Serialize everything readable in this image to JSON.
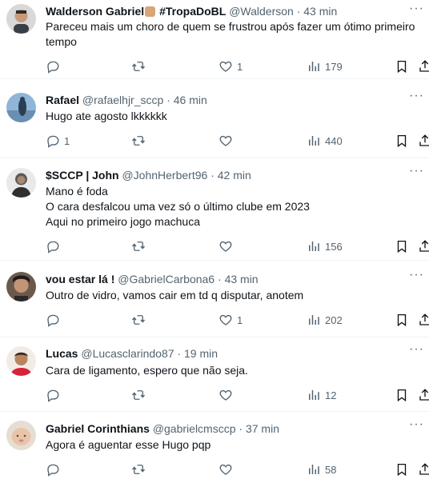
{
  "tweets": [
    {
      "name": "Walderson Gabriel",
      "name_suffix": "#TropaDoBL",
      "handle": "@Walderson",
      "time": "43 min",
      "lines": [
        "Pareceu mais um choro de quem se frustrou após fazer um ótimo primeiro",
        "tempo"
      ],
      "replies": "",
      "likes": "1",
      "views": "179"
    },
    {
      "name": "Rafael",
      "handle": "@rafaelhjr_sccp",
      "time": "46 min",
      "lines": [
        "Hugo ate agosto lkkkkkk"
      ],
      "replies": "1",
      "likes": "",
      "views": "440"
    },
    {
      "name": "$SCCP | John",
      "handle": "@JohnHerbert96",
      "time": "42 min",
      "lines": [
        "Mano é foda",
        "O cara desfalcou uma vez só o último clube em 2023",
        "Aqui no primeiro jogo machuca"
      ],
      "replies": "",
      "likes": "",
      "views": "156"
    },
    {
      "name": "vou estar lá !",
      "handle": "@GabrielCarbona6",
      "time": "43 min",
      "lines": [
        "Outro de vidro, vamos cair em td q disputar, anotem"
      ],
      "replies": "",
      "likes": "1",
      "views": "202"
    },
    {
      "name": "Lucas",
      "handle": "@Lucasclarindo87",
      "time": "19 min",
      "lines": [
        "Cara de ligamento,  espero que não seja."
      ],
      "replies": "",
      "likes": "",
      "views": "12"
    },
    {
      "name": "Gabriel Corinthians",
      "handle": "@gabrielcmsccp",
      "time": "37 min",
      "lines": [
        "Agora é aguentar esse Hugo pqp"
      ],
      "replies": "",
      "likes": "",
      "views": "58"
    }
  ],
  "separator": "·",
  "more_glyph": "···"
}
